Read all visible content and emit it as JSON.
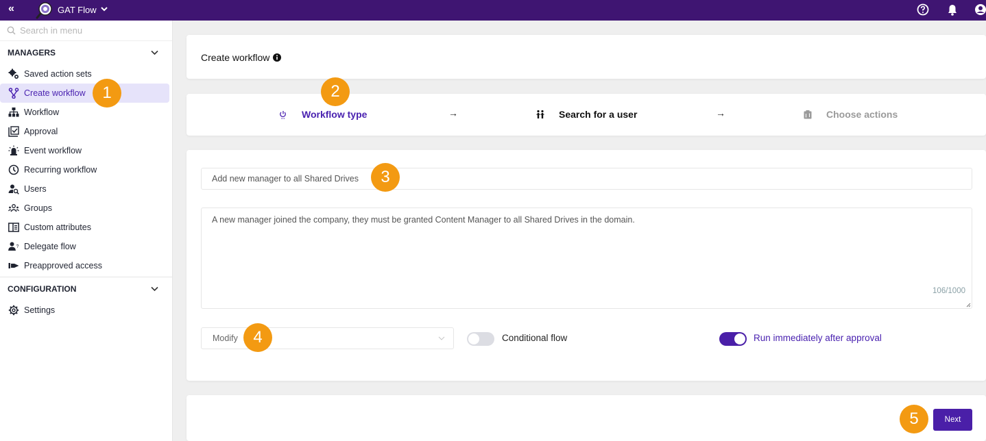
{
  "topbar": {
    "collapse_icon": "double-chevron-left-icon",
    "collapse_glyph": "«",
    "app_name": "GAT Flow",
    "icons": [
      "help-circle-icon",
      "bell-icon",
      "user-account-icon"
    ]
  },
  "sidebar": {
    "search_placeholder": "Search in menu",
    "sections": [
      {
        "title": "MANAGERS",
        "items": [
          {
            "label": "Saved action sets",
            "icon": "gears-icon"
          },
          {
            "label": "Create workflow",
            "icon": "fork-icon",
            "active": true
          },
          {
            "label": "Workflow",
            "icon": "sitemap-icon"
          },
          {
            "label": "Approval",
            "icon": "approval-checklist-icon"
          },
          {
            "label": "Event workflow",
            "icon": "alarm-light-icon"
          },
          {
            "label": "Recurring workflow",
            "icon": "clock-icon"
          },
          {
            "label": "Users",
            "icon": "user-search-icon"
          },
          {
            "label": "Groups",
            "icon": "group-icon"
          },
          {
            "label": "Custom attributes",
            "icon": "attributes-panel-icon"
          },
          {
            "label": "Delegate flow",
            "icon": "user-question-icon"
          },
          {
            "label": "Preapproved access",
            "icon": "hand-pointing-icon"
          }
        ]
      },
      {
        "title": "CONFIGURATION",
        "items": [
          {
            "label": "Settings",
            "icon": "gear-icon"
          }
        ]
      }
    ]
  },
  "header_card": {
    "title": "Create workflow",
    "info_icon": "info-icon"
  },
  "stepper": {
    "steps": [
      {
        "label": "Workflow type",
        "icon": "power-icon",
        "state": "active"
      },
      {
        "label": "Search for a user",
        "icon": "people-icon",
        "state": "pending"
      },
      {
        "label": "Choose actions",
        "icon": "clipboard-icon",
        "state": "disabled"
      }
    ],
    "arrow_glyph": "→"
  },
  "form": {
    "title_value": "Add new manager to all Shared Drives",
    "description_value": "A new manager joined the company, they must be granted Content Manager to all Shared Drives in the domain.",
    "char_count": "106/1000",
    "type_select_value": "Modify",
    "conditional_flow_label": "Conditional flow",
    "conditional_flow_on": false,
    "run_immediately_label": "Run immediately after approval",
    "run_immediately_on": true
  },
  "footer": {
    "next_label": "Next"
  },
  "annotations": [
    "1",
    "2",
    "3",
    "4",
    "5"
  ],
  "colors": {
    "topbar": "#3f1572",
    "accent": "#4a1fa8",
    "active_bg": "#e6e3fa",
    "badge": "#f39a12",
    "disabled_text": "#9a9a9a"
  }
}
